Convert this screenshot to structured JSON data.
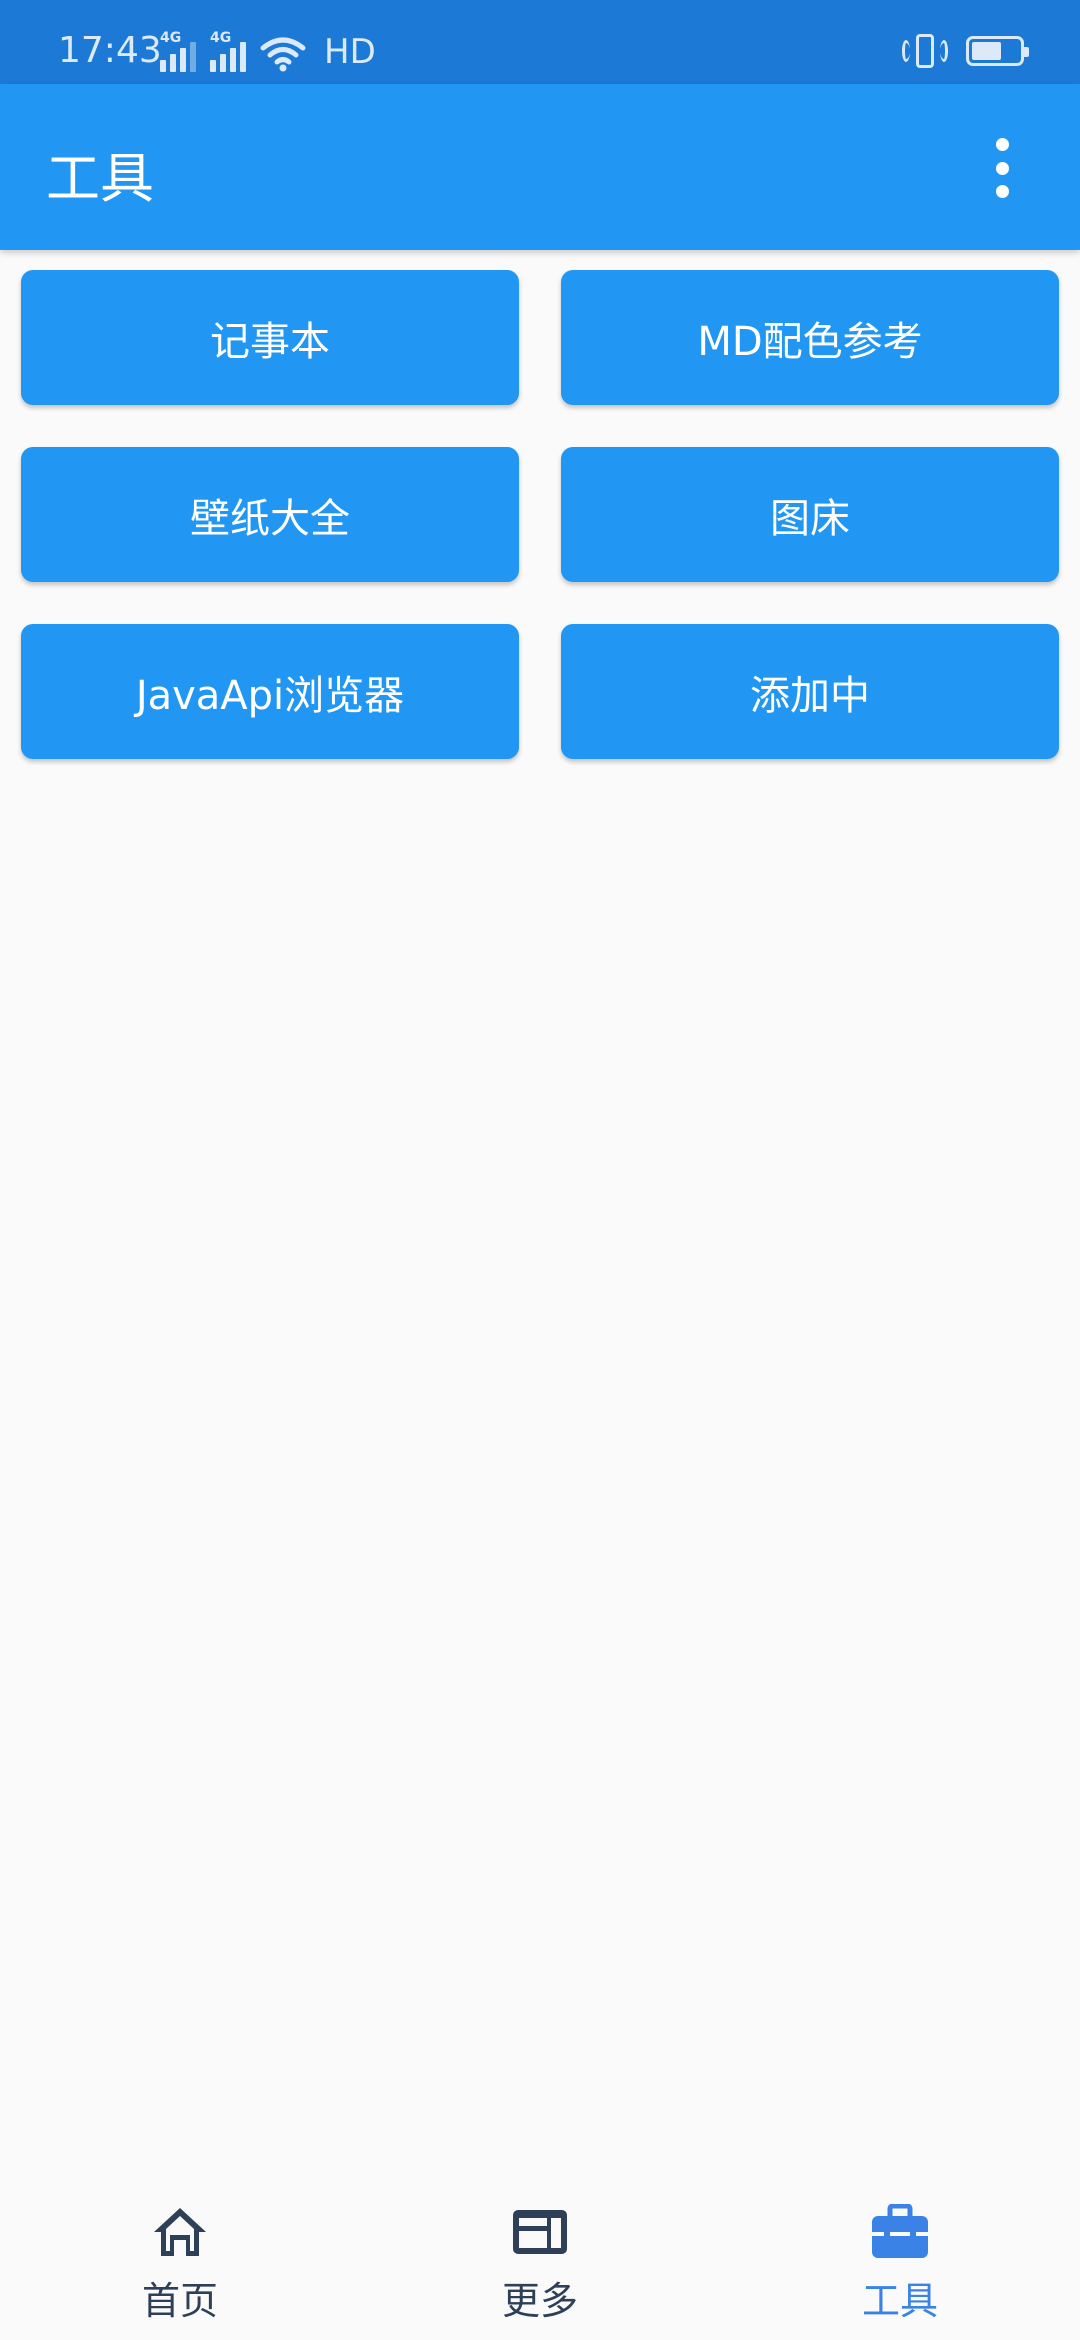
{
  "status_bar": {
    "time": "17:43",
    "signal1_label": "4G",
    "signal2_label": "4G",
    "hd_label": "HD"
  },
  "app_bar": {
    "title": "工具"
  },
  "tools": {
    "items": [
      {
        "label": "记事本"
      },
      {
        "label": "MD配色参考"
      },
      {
        "label": "壁纸大全"
      },
      {
        "label": "图床"
      },
      {
        "label": "JavaApi浏览器"
      },
      {
        "label": "添加中"
      }
    ]
  },
  "bottom_nav": {
    "items": [
      {
        "label": "首页",
        "icon": "home-icon",
        "active": false
      },
      {
        "label": "更多",
        "icon": "dashboard-icon",
        "active": false
      },
      {
        "label": "工具",
        "icon": "toolbox-icon",
        "active": true
      }
    ]
  },
  "colors": {
    "primary": "#2196f3",
    "status_bar": "#1c7ad6",
    "nav_active": "#3b82e6",
    "nav_inactive": "#2e4057",
    "background": "#fafafa"
  }
}
